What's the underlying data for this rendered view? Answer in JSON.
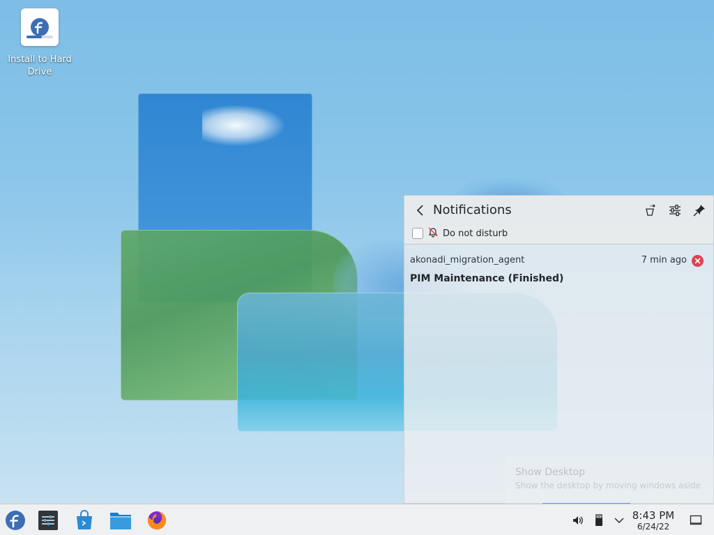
{
  "desktop": {
    "icons": [
      {
        "label": "Install to Hard Drive",
        "icon": "fedora-installer-icon"
      }
    ]
  },
  "notifications": {
    "title": "Notifications",
    "back_icon": "back-arrow-icon",
    "clear_icon": "clear-all-icon",
    "configure_icon": "configure-icon",
    "pin_icon": "pin-icon",
    "do_not_disturb": {
      "label": "Do not disturb",
      "checked": false,
      "icon": "bell-disabled-icon"
    },
    "items": [
      {
        "app": "akonadi_migration_agent",
        "time": "7 min ago",
        "summary": "PIM Maintenance (Finished)"
      }
    ]
  },
  "tooltip": {
    "title": "Show Desktop",
    "subtitle": "Show the desktop by moving windows aside"
  },
  "taskbar": {
    "launcher_icon": "fedora-logo-icon",
    "apps": [
      {
        "name": "system-settings",
        "icon": "settings-sliders-icon"
      },
      {
        "name": "discover",
        "icon": "store-bag-icon"
      },
      {
        "name": "file-manager",
        "icon": "folder-icon"
      },
      {
        "name": "firefox",
        "icon": "firefox-icon"
      }
    ],
    "tray": [
      {
        "name": "volume",
        "icon": "speaker-icon"
      },
      {
        "name": "removable-devices",
        "icon": "usb-icon"
      },
      {
        "name": "expand",
        "icon": "chevron-down-icon"
      }
    ],
    "clock": {
      "time": "8:43 PM",
      "date": "6/24/22"
    },
    "show_desktop_icon": "show-desktop-icon"
  },
  "colors": {
    "accent": "#3daee9",
    "close": "#da4453",
    "fedora_blue": "#3c6eb4",
    "panel_bg": "#eff0f1"
  }
}
